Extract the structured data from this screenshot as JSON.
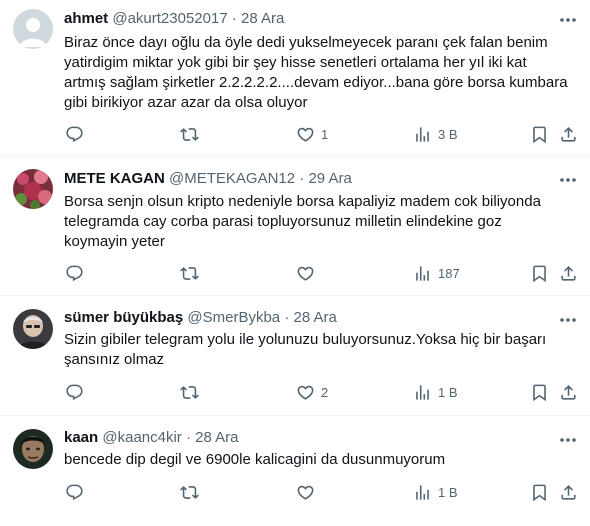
{
  "tweets": [
    {
      "name": "ahmet",
      "handle": "@akurt23052017",
      "separator": "·",
      "date": "28 Ara",
      "text": "Biraz önce dayı oğlu da öyle dedi yukselmeyecek paranı çek falan benim\nyatirdigim miktar yok gibi bir şey hisse senetleri  ortalama her yıl iki kat\nartmış sağlam şirketler 2.2.2.2.2....devam ediyor...bana göre borsa kumbara\ngibi birikiyor azar azar da olsa  oluyor",
      "replies": "",
      "retweets": "",
      "likes": "1",
      "views": "3 B"
    },
    {
      "name": "METE KAGAN",
      "handle": "@METEKAGAN12",
      "separator": "·",
      "date": "29 Ara",
      "text": "Borsa senjn olsun kripto nedeniyle borsa kapaliyiz madem cok biliyonda\ntelegramda cay corba parasi topluyorsunuz milletin elindekine goz\nkoymayin yeter",
      "replies": "",
      "retweets": "",
      "likes": "",
      "views": "187"
    },
    {
      "name": "sümer büyükbaş",
      "handle": "@SmerBykba",
      "separator": "·",
      "date": "28 Ara",
      "text": "Sizin gibiler telegram yolu ile yolunuzu buluyorsunuz.Yoksa hiç  bir  başarı\nşansınız  olmaz",
      "replies": "",
      "retweets": "",
      "likes": "2",
      "views": "1 B"
    },
    {
      "name": "kaan",
      "handle": "@kaanc4kir",
      "separator": "·",
      "date": "28 Ara",
      "text": "bencede dip degil ve 6900le kalicagini da dusunmuyorum",
      "replies": "",
      "retweets": "",
      "likes": "",
      "views": "1 B"
    }
  ],
  "colors": {
    "text": "#0f1419",
    "secondary": "#536471",
    "border": "#eff3f4"
  },
  "icons": [
    "more-icon",
    "reply-icon",
    "retweet-icon",
    "like-icon",
    "views-icon",
    "bookmark-icon",
    "share-icon"
  ]
}
